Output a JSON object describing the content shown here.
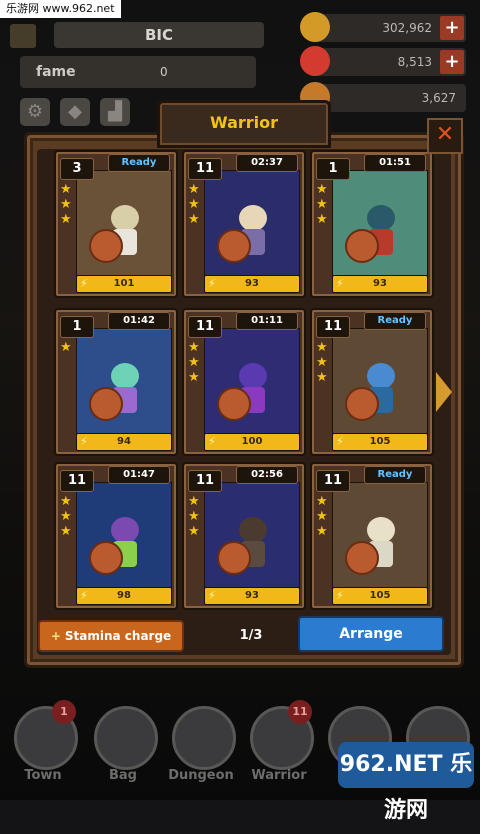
{
  "watermark_top": "乐游网 www.962.net",
  "profile": {
    "name": "BIC",
    "fame_label": "fame",
    "fame_value": "0"
  },
  "resources": [
    {
      "icon": "gold-coin-icon",
      "value": "302,962",
      "color": "#d49a28"
    },
    {
      "icon": "ruby-icon",
      "value": "8,513",
      "color": "#d33b2e"
    },
    {
      "icon": "medal-icon",
      "value": "3,627",
      "color": "#c47a2a"
    }
  ],
  "dialog": {
    "title": "Warrior",
    "close": "✕"
  },
  "cards": [
    {
      "level": "3",
      "status": "Ready",
      "status_type": "ready",
      "stars": 3,
      "power": "101",
      "bg": "#6a5238",
      "hair": "#d8cfa8",
      "outfit": "#e9e4dc"
    },
    {
      "level": "11",
      "status": "02:37",
      "status_type": "timer",
      "stars": 3,
      "power": "93",
      "bg": "#2b2c6a",
      "hair": "#e7d7b8",
      "outfit": "#7a6da8"
    },
    {
      "level": "1",
      "status": "01:51",
      "status_type": "timer",
      "stars": 3,
      "power": "93",
      "bg": "#4f8d7a",
      "hair": "#2a5a6a",
      "outfit": "#b83a2a"
    },
    {
      "level": "1",
      "status": "01:42",
      "status_type": "timer",
      "stars": 1,
      "power": "94",
      "bg": "#2d4e8a",
      "hair": "#6ed3b6",
      "outfit": "#9a6ad0"
    },
    {
      "level": "11",
      "status": "01:11",
      "status_type": "timer",
      "stars": 3,
      "power": "100",
      "bg": "#2e2d74",
      "hair": "#5a3ab0",
      "outfit": "#8a3ac0"
    },
    {
      "level": "11",
      "status": "Ready",
      "status_type": "ready",
      "stars": 3,
      "power": "105",
      "bg": "#5e4a34",
      "hair": "#4a8ad0",
      "outfit": "#2a6aa0"
    },
    {
      "level": "11",
      "status": "01:47",
      "status_type": "timer",
      "stars": 3,
      "power": "98",
      "bg": "#1f3b78",
      "hair": "#7a4ab0",
      "outfit": "#8ad04a"
    },
    {
      "level": "11",
      "status": "02:56",
      "status_type": "timer",
      "stars": 3,
      "power": "93",
      "bg": "#2a2d70",
      "hair": "#4a3a30",
      "outfit": "#5a4a40"
    },
    {
      "level": "11",
      "status": "Ready",
      "status_type": "ready",
      "stars": 3,
      "power": "105",
      "bg": "#5e4a34",
      "hair": "#e9e0c8",
      "outfit": "#dcd8c8"
    }
  ],
  "buttons": {
    "stamina": "Stamina charge",
    "stamina_icon": "+",
    "arrange": "Arrange",
    "page": "1/3"
  },
  "nav": [
    {
      "label": "Town",
      "badge": "1"
    },
    {
      "label": "Bag",
      "badge": ""
    },
    {
      "label": "Dungeon",
      "badge": ""
    },
    {
      "label": "Warrior",
      "badge": "11"
    },
    {
      "label": "",
      "badge": ""
    },
    {
      "label": "",
      "badge": ""
    }
  ],
  "watermark_logo": "962.NET 乐游网"
}
